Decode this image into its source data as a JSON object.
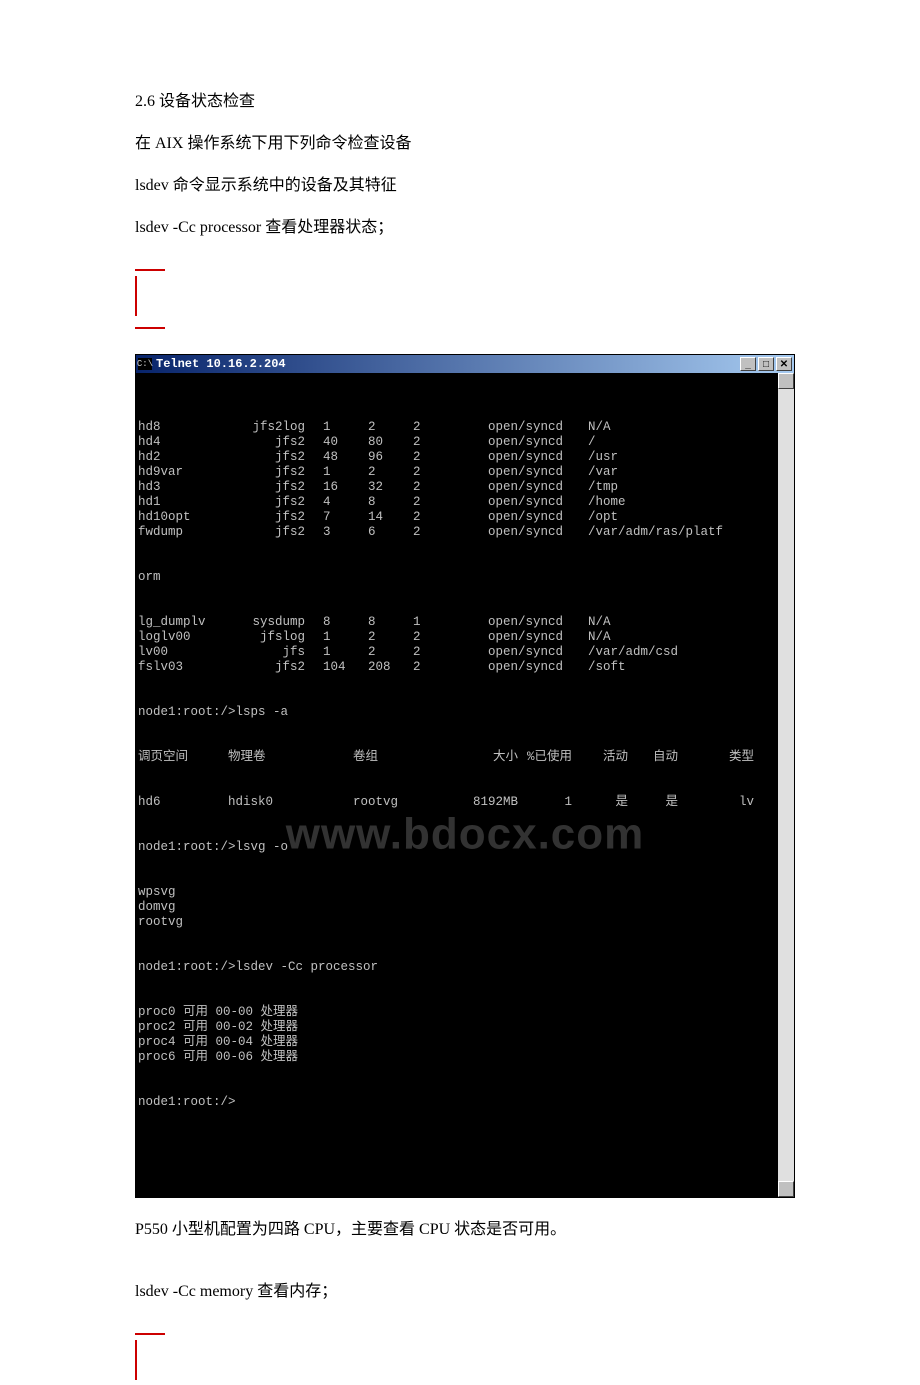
{
  "doc": {
    "heading": "2.6 设备状态检查",
    "line1": " 在 AIX 操作系统下用下列命令检查设备",
    "line2": "lsdev 命令显示系统中的设备及其特征",
    "line3": "lsdev -Cc processor 查看处理器状态；",
    "caption1": "P550 小型机配置为四路 CPU，主要查看 CPU 状态是否可用。",
    "line4": "lsdev -Cc memory 查看内存；"
  },
  "terminal": {
    "title": "Telnet 10.16.2.204",
    "watermark": "www.bdocx.com",
    "rows": [
      {
        "name": "hd8",
        "fs": "jfs2log",
        "a": "1",
        "b": "2",
        "c": "2",
        "d": "",
        "st": "open/syncd",
        "mp": "N/A"
      },
      {
        "name": "hd4",
        "fs": "jfs2",
        "a": "40",
        "b": "80",
        "c": "2",
        "d": "",
        "st": "open/syncd",
        "mp": "/"
      },
      {
        "name": "hd2",
        "fs": "jfs2",
        "a": "48",
        "b": "96",
        "c": "2",
        "d": "",
        "st": "open/syncd",
        "mp": "/usr"
      },
      {
        "name": "hd9var",
        "fs": "jfs2",
        "a": "1",
        "b": "2",
        "c": "2",
        "d": "",
        "st": "open/syncd",
        "mp": "/var"
      },
      {
        "name": "hd3",
        "fs": "jfs2",
        "a": "16",
        "b": "32",
        "c": "2",
        "d": "",
        "st": "open/syncd",
        "mp": "/tmp"
      },
      {
        "name": "hd1",
        "fs": "jfs2",
        "a": "4",
        "b": "8",
        "c": "2",
        "d": "",
        "st": "open/syncd",
        "mp": "/home"
      },
      {
        "name": "hd10opt",
        "fs": "jfs2",
        "a": "7",
        "b": "14",
        "c": "2",
        "d": "",
        "st": "open/syncd",
        "mp": "/opt"
      },
      {
        "name": "fwdump",
        "fs": "jfs2",
        "a": "3",
        "b": "6",
        "c": "2",
        "d": "",
        "st": "open/syncd",
        "mp": "/var/adm/ras/platf"
      }
    ],
    "orm": "orm",
    "rows2": [
      {
        "name": "lg_dumplv",
        "fs": "sysdump",
        "a": "8",
        "b": "8",
        "c": "1",
        "d": "",
        "st": "open/syncd",
        "mp": "N/A"
      },
      {
        "name": "loglv00",
        "fs": "jfslog",
        "a": "1",
        "b": "2",
        "c": "2",
        "d": "",
        "st": "open/syncd",
        "mp": "N/A"
      },
      {
        "name": "lv00",
        "fs": "jfs",
        "a": "1",
        "b": "2",
        "c": "2",
        "d": "",
        "st": "open/syncd",
        "mp": "/var/adm/csd"
      },
      {
        "name": "fslv03",
        "fs": "jfs2",
        "a": "104",
        "b": "208",
        "c": "2",
        "d": "",
        "st": "open/syncd",
        "mp": "/soft"
      }
    ],
    "prompt1": "node1:root:/>lsps -a",
    "ps_headers": {
      "h1": "调页空间",
      "h2": "物理卷",
      "h3": "卷组",
      "h4": "大小",
      "h5": "%已使用",
      "h6": "活动",
      "h7": "自动",
      "h8": "类型"
    },
    "ps_row": {
      "h1": "hd6",
      "h2": "hdisk0",
      "h3": "rootvg",
      "h4": "8192MB",
      "h5": "1",
      "h6": "是",
      "h7": "是",
      "h8": "lv"
    },
    "prompt2": "node1:root:/>lsvg -o",
    "vgs": [
      "wpsvg",
      "domvg",
      "rootvg"
    ],
    "prompt3": "node1:root:/>lsdev -Cc processor",
    "procs": [
      "proc0 可用 00-00 处理器",
      "proc2 可用 00-02 处理器",
      "proc4 可用 00-04 处理器",
      "proc6 可用 00-06 处理器"
    ],
    "prompt4": "node1:root:/>"
  },
  "icons": {
    "minimize": "_",
    "maximize": "□",
    "close": "✕",
    "up": "▲",
    "down": "▼"
  }
}
